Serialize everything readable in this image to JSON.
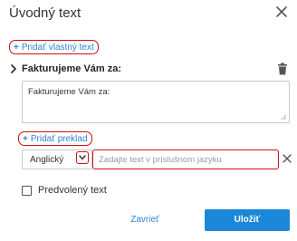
{
  "dialog": {
    "title": "Úvodný text",
    "add_custom_text_label": "Pridať vlastný text",
    "add_icon_glyph": "+",
    "section_title": "Fakturujeme Vám za:",
    "textarea_value": "Fakturujeme Vám za:",
    "add_translation_label": "Pridať preklad",
    "language_value": "Anglický",
    "translation_placeholder": "Zadajte text v príslušnom jazyku",
    "default_text_label": "Predvolený text",
    "cancel_label": "Zavrieť",
    "save_label": "Uložiť"
  },
  "colors": {
    "accent": "#1a87d8",
    "link": "#2f84d2",
    "highlight": "#d01010",
    "border": "#c8c8c8"
  },
  "icons": {
    "close": "close-icon",
    "chevron": "chevron-right-icon",
    "trash": "trash-icon",
    "dropdown": "chevron-down-icon"
  }
}
